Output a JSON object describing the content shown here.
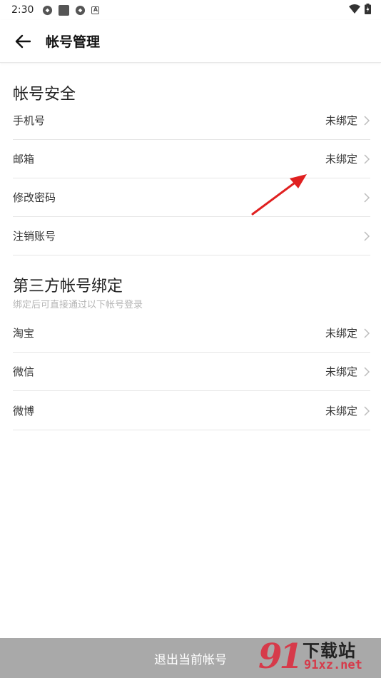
{
  "status_bar": {
    "time": "2:30"
  },
  "app_bar": {
    "title": "帐号管理"
  },
  "account_security": {
    "title": "帐号安全",
    "items": [
      {
        "label": "手机号",
        "value": "未绑定"
      },
      {
        "label": "邮箱",
        "value": "未绑定"
      },
      {
        "label": "修改密码",
        "value": ""
      },
      {
        "label": "注销账号",
        "value": ""
      }
    ]
  },
  "third_party": {
    "title": "第三方帐号绑定",
    "subtitle": "绑定后可直接通过以下帐号登录",
    "items": [
      {
        "label": "淘宝",
        "value": "未绑定"
      },
      {
        "label": "微信",
        "value": "未绑定"
      },
      {
        "label": "微博",
        "value": "未绑定"
      }
    ]
  },
  "logout": {
    "label": "退出当前帐号"
  },
  "watermark": {
    "logo": "91",
    "brand": "下载站",
    "url": "91xz.net"
  },
  "colors": {
    "logout_bg": "#a9a9a9",
    "annotation_arrow": "#e02020",
    "watermark_red": "#d63a4a",
    "divider": "#e6e6e6"
  }
}
